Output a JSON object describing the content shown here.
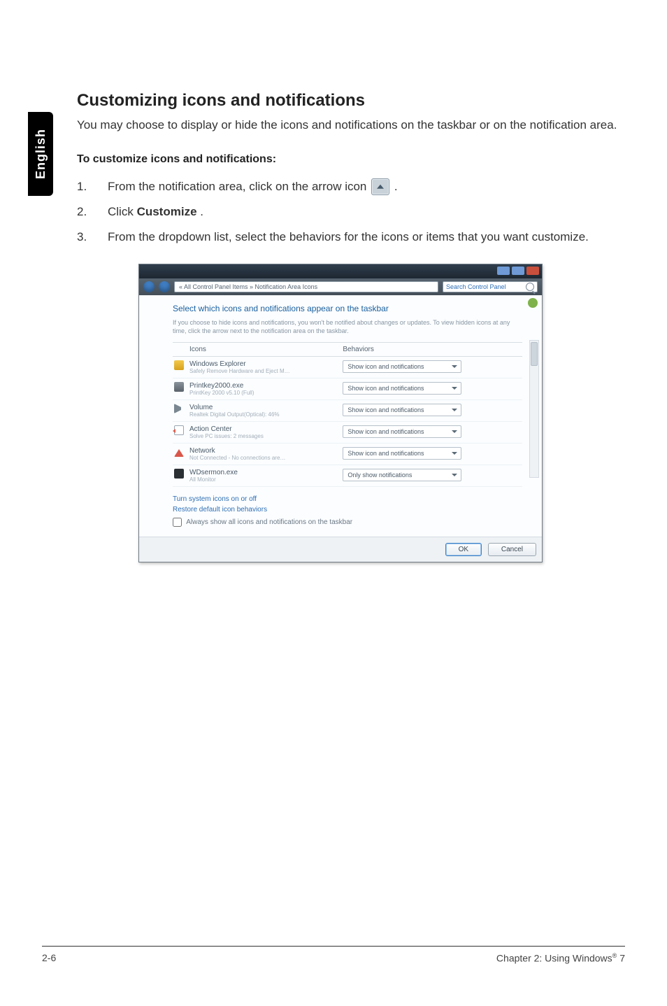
{
  "sidetab": {
    "label": "English"
  },
  "heading": "Customizing icons and notifications",
  "intro": "You may choose to display or hide the icons and notifications on the taskbar or on the notification area.",
  "subhead": "To customize icons and notifications:",
  "steps": {
    "s1a": "From the notification area, click on the arrow icon ",
    "s1b": ".",
    "s2a": "Click ",
    "s2b": "Customize",
    "s2c": ".",
    "s3": "From the dropdown list, select the behaviors for the icons or items that you want customize."
  },
  "shot": {
    "breadcrumb": "« All Control Panel Items » Notification Area Icons",
    "search_placeholder": "Search Control Panel",
    "header": "Select which icons and notifications appear on the taskbar",
    "hint": "If you choose to hide icons and notifications, you won't be notified about changes or updates. To view hidden icons at any time, click the arrow next to the notification area on the taskbar.",
    "col_icons": "Icons",
    "col_behaviors": "Behaviors",
    "rows": [
      {
        "name": "Windows Explorer",
        "sub": "Safely Remove Hardware and Eject M…",
        "behavior": "Show icon and notifications"
      },
      {
        "name": "Printkey2000.exe",
        "sub": "PrintKey 2000 v5.10 (Full)",
        "behavior": "Show icon and notifications"
      },
      {
        "name": "Volume",
        "sub": "Realtek Digital Output(Optical): 46%",
        "behavior": "Show icon and notifications"
      },
      {
        "name": "Action Center",
        "sub": "Solve PC issues: 2 messages",
        "behavior": "Show icon and notifications"
      },
      {
        "name": "Network",
        "sub": "Not Connected - No connections are…",
        "behavior": "Show icon and notifications"
      },
      {
        "name": "WDsermon.exe",
        "sub": "All Monitor",
        "behavior": "Only show notifications"
      }
    ],
    "link1": "Turn system icons on or off",
    "link2": "Restore default icon behaviors",
    "checkbox": "Always show all icons and notifications on the taskbar",
    "ok": "OK",
    "cancel": "Cancel"
  },
  "footer": {
    "left": "2-6",
    "right_a": "Chapter 2: Using Windows",
    "right_b": " 7",
    "reg": "®"
  }
}
